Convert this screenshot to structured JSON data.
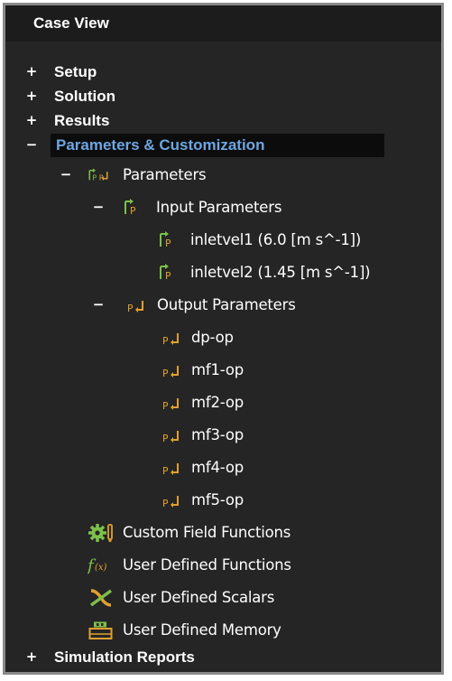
{
  "panel": {
    "title": "Case View"
  },
  "tree": {
    "setup": {
      "toggle": "+",
      "label": "Setup"
    },
    "solution": {
      "toggle": "+",
      "label": "Solution"
    },
    "results": {
      "toggle": "+",
      "label": "Results"
    },
    "params_custom": {
      "toggle": "−",
      "label": "Parameters & Customization"
    },
    "parameters": {
      "toggle": "−",
      "label": "Parameters"
    },
    "input_parameters": {
      "toggle": "−",
      "label": "Input Parameters"
    },
    "inputs": [
      {
        "label": "inletvel1 (6.0 [m s^-1])"
      },
      {
        "label": "inletvel2 (1.45 [m s^-1])"
      }
    ],
    "output_parameters": {
      "toggle": "−",
      "label": "Output Parameters"
    },
    "outputs": [
      {
        "label": "dp-op"
      },
      {
        "label": "mf1-op"
      },
      {
        "label": "mf2-op"
      },
      {
        "label": "mf3-op"
      },
      {
        "label": "mf4-op"
      },
      {
        "label": "mf5-op"
      }
    ],
    "custom_field_functions": {
      "label": "Custom Field Functions",
      "icon": "gear-icon"
    },
    "user_defined_functions": {
      "label": "User Defined Functions",
      "icon": "fx-icon",
      "icon_text": "f(x)"
    },
    "user_defined_scalars": {
      "label": "User Defined Scalars",
      "icon": "scalar-icon"
    },
    "user_defined_memory": {
      "label": "User Defined Memory",
      "icon": "memory-icon"
    },
    "simulation_reports": {
      "toggle": "+",
      "label": "Simulation Reports"
    }
  },
  "colors": {
    "background": "#252525",
    "selected_text": "#6ea6e2",
    "icon_green": "#7cc04a",
    "icon_orange": "#e0a030"
  }
}
